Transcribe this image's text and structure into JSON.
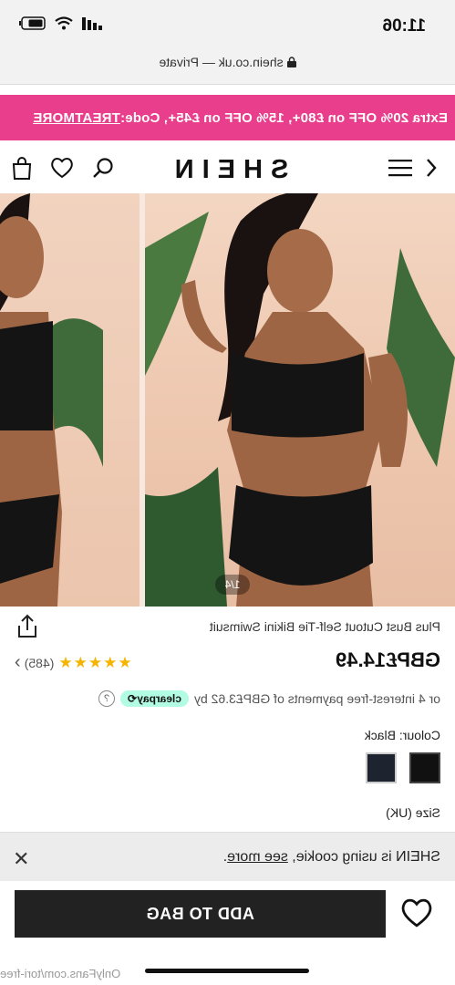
{
  "status_bar": {
    "time": "11:06"
  },
  "address_bar": {
    "url": "shein.co.uk — Private"
  },
  "promo": {
    "text": "Extra 20% OFF on £80+, 15% OFF on £45+, Code:",
    "code": "TREATMORE"
  },
  "nav": {
    "logo": "SHEIN"
  },
  "gallery": {
    "counter": "1/4"
  },
  "product": {
    "title": "Plus Bust Cutout Self-Tie Bikini Swimsuit",
    "price": "GBP£14.49",
    "stars": "★★★★★",
    "reviews": "(485)",
    "rating_arrow": "›",
    "installment_text": "or 4 interest-free payments of GBP£3.62 by",
    "clearpay": "clearpay⟲",
    "colour_label": "Colour: Black",
    "size_label": "Size (UK)"
  },
  "cookie": {
    "text": "SHEIN is using cookie,",
    "more": "see more",
    "period": "."
  },
  "bottom": {
    "add_to_bag": "ADD TO BAG",
    "watermark": "OnlyFans.com/tori-free"
  }
}
